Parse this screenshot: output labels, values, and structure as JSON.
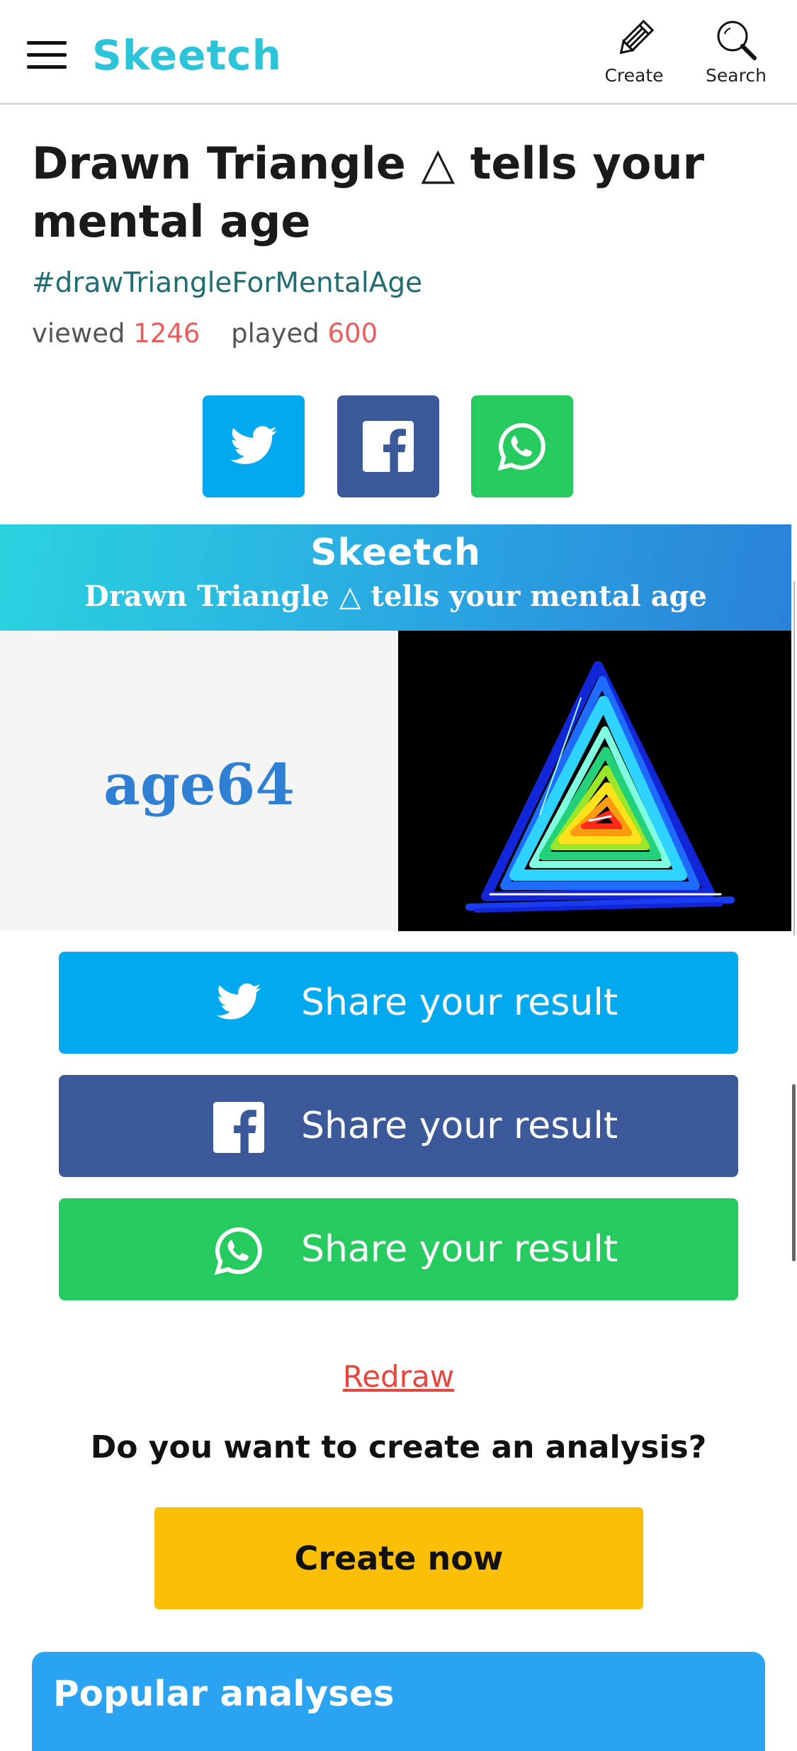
{
  "header": {
    "logo": "Skeetch",
    "create_label": "Create",
    "search_label": "Search"
  },
  "analysis": {
    "title": "Drawn Triangle △ tells your mental age",
    "hashtag": "#drawTriangleForMentalAge",
    "viewed_label": "viewed",
    "viewed_count": "1246",
    "played_label": "played",
    "played_count": "600"
  },
  "result_image": {
    "banner_logo": "Skeetch",
    "banner_subtitle": "Drawn Triangle △ tells your mental age",
    "result_text": "age64"
  },
  "share": {
    "twitter_label": "Share your result",
    "facebook_label": "Share your result",
    "whatsapp_label": "Share your result"
  },
  "redraw_label": "Redraw",
  "cta": {
    "question": "Do you want to create an analysis?",
    "button_label": "Create now"
  },
  "popular": {
    "title": "Popular analyses"
  },
  "colors": {
    "brand": "#2bc4d8",
    "twitter": "#03a9ee",
    "facebook": "#3b5998",
    "whatsapp": "#26cb5f",
    "cta": "#fbbf07",
    "popular": "#2aa3f3",
    "count": "#ef5a5a",
    "redraw": "#e8453c"
  },
  "icons": {
    "menu": "hamburger-menu-icon",
    "create": "pencil-icon",
    "search": "magnifier-icon",
    "twitter": "twitter-bird-icon",
    "facebook": "facebook-f-icon",
    "whatsapp": "whatsapp-phone-icon"
  }
}
